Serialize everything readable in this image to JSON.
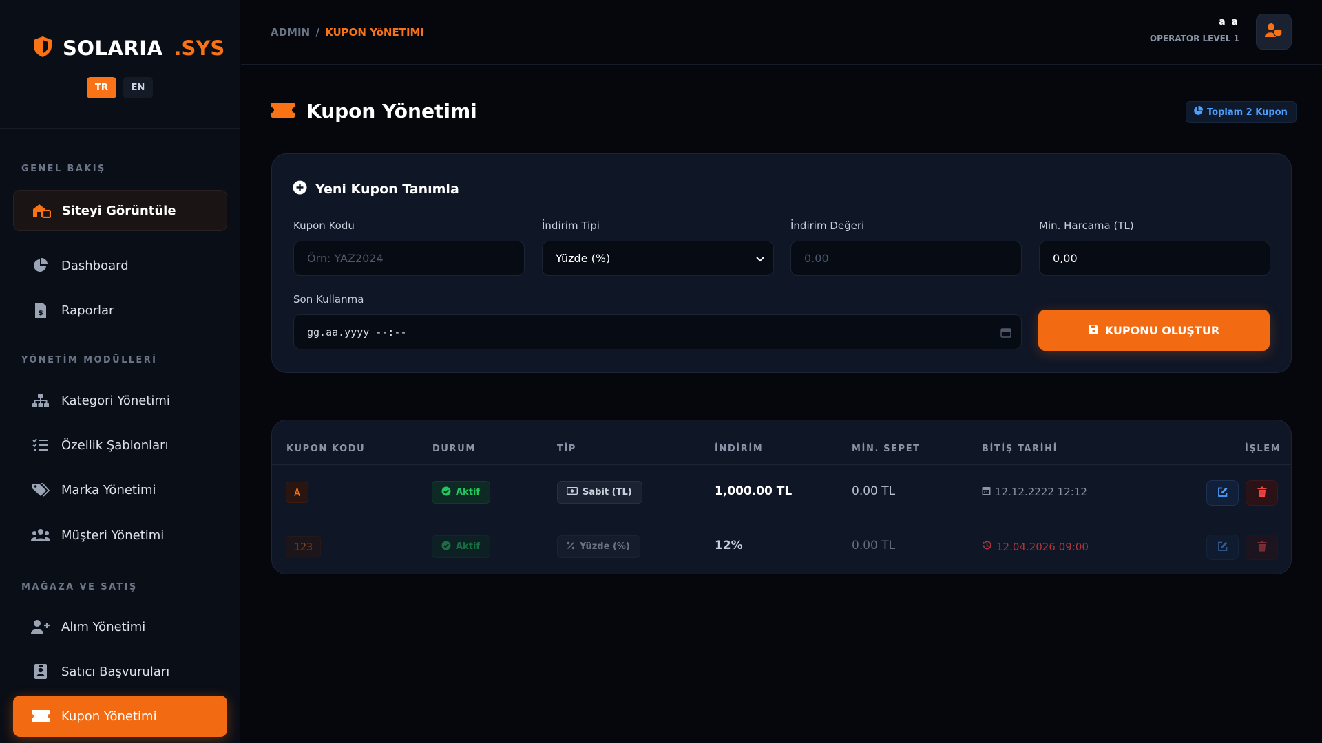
{
  "brand": {
    "name": "SOLARIA",
    "suffix": ".SYS"
  },
  "languages": [
    "TR",
    "EN"
  ],
  "sidebar": {
    "sections": [
      "GENEL BAKIŞ",
      "YÖNETİM MODÜLLERİ",
      "MAĞAZA VE SATIŞ"
    ],
    "items": [
      {
        "label": "Siteyi Görüntüle",
        "icon": "store-icon"
      },
      {
        "label": "Dashboard",
        "icon": "pie-chart-icon"
      },
      {
        "label": "Raporlar",
        "icon": "invoice-icon"
      },
      {
        "label": "Kategori Yönetimi",
        "icon": "sitemap-icon"
      },
      {
        "label": "Özellik Şablonları",
        "icon": "list-check-icon"
      },
      {
        "label": "Marka Yönetimi",
        "icon": "tags-icon"
      },
      {
        "label": "Müşteri Yönetimi",
        "icon": "users-icon"
      },
      {
        "label": "Alım Yönetimi",
        "icon": "user-plus-icon"
      },
      {
        "label": "Satıcı Başvuruları",
        "icon": "id-badge-icon"
      },
      {
        "label": "Kupon Yönetimi",
        "icon": "ticket-icon"
      }
    ]
  },
  "topbar": {
    "breadcrumb_root": "ADMIN",
    "breadcrumb_sep": "/",
    "breadcrumb_current": "KUPON YöNETIMI",
    "user_name": "a a",
    "user_role": "OPERATOR LEVEL 1"
  },
  "page": {
    "title": "Kupon Yönetimi",
    "total_badge": "Toplam 2 Kupon"
  },
  "form": {
    "title": "Yeni Kupon Tanımla",
    "code_label": "Kupon Kodu",
    "code_placeholder": "Örn: YAZ2024",
    "type_label": "İndirim Tipi",
    "type_value": "Yüzde (%)",
    "value_label": "İndirim Değeri",
    "value_placeholder": "0.00",
    "min_label": "Min. Harcama (TL)",
    "min_value": "0,00",
    "expiry_label": "Son Kullanma",
    "expiry_placeholder": "gg.aa.yyyy --:--",
    "submit_label": "KUPONU OLUŞTUR"
  },
  "table": {
    "headers": [
      "KUPON KODU",
      "DURUM",
      "TİP",
      "İNDİRİM",
      "MİN. SEPET",
      "BİTİŞ TARİHİ",
      "İŞLEM"
    ],
    "rows": [
      {
        "code": "A",
        "status": "Aktif",
        "type": "Sabit (TL)",
        "discount": "1,000.00 TL",
        "min_basket": "0.00 TL",
        "expiry": "12.12.2222 12:12",
        "expired": false
      },
      {
        "code": "123",
        "status": "Aktif",
        "type": "Yüzde (%)",
        "discount": "12%",
        "min_basket": "0.00 TL",
        "expiry": "12.04.2026 09:00",
        "expired": true
      }
    ]
  },
  "colors": {
    "accent": "#f97316",
    "success": "#22c55e",
    "danger": "#ef4444",
    "info": "#4ea0ff"
  }
}
